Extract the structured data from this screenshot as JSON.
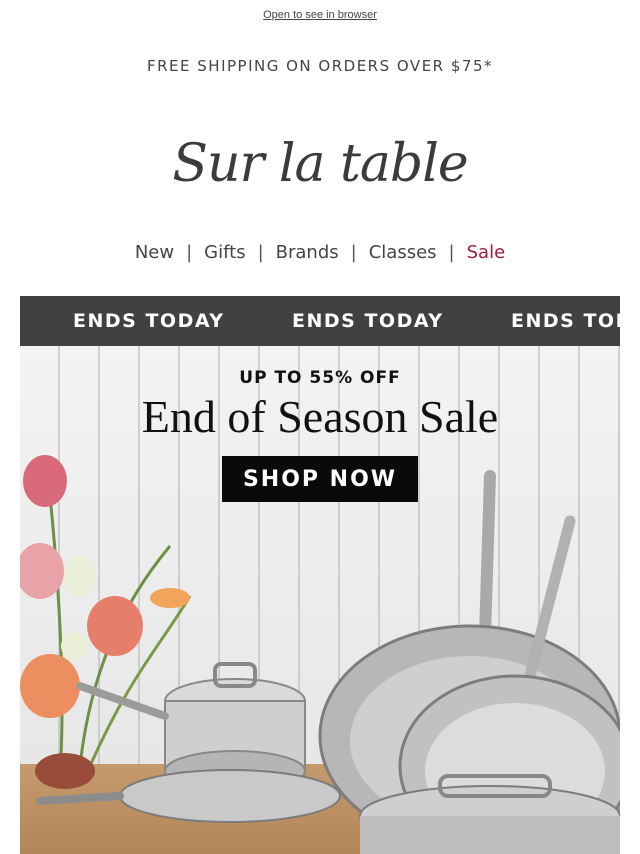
{
  "header": {
    "browser_link": "Open to see in browser",
    "shipping": "FREE SHIPPING ON ORDERS OVER $75*",
    "logo": "Sur la table"
  },
  "nav": {
    "items": [
      "New",
      "Gifts",
      "Brands",
      "Classes",
      "Sale"
    ],
    "separator": "|"
  },
  "ticker": {
    "items": [
      "ENDS TODAY",
      "ENDS TODAY",
      "ENDS TODAY"
    ]
  },
  "hero": {
    "eyebrow": "UP TO 55% OFF",
    "headline": "End of Season Sale",
    "cta": "SHOP NOW"
  },
  "colors": {
    "ticker_bg": "#414143",
    "sale": "#a4193d",
    "cta_bg": "#0a0a0a"
  }
}
